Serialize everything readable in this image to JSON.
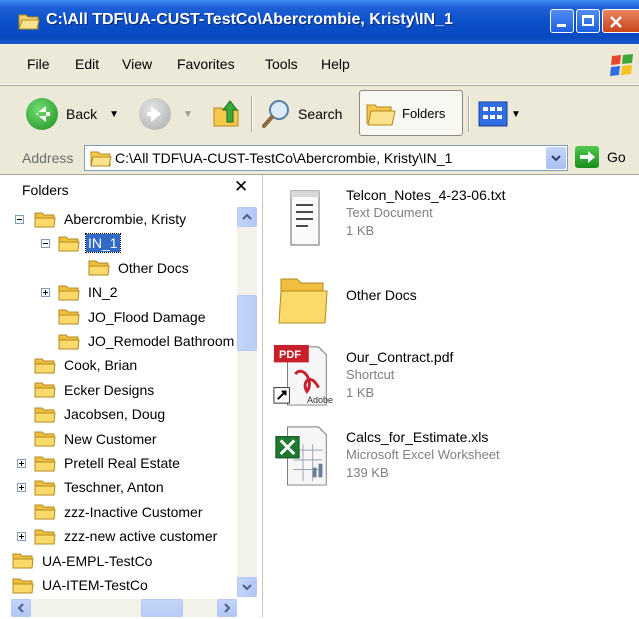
{
  "window": {
    "title": "C:\\All TDF\\UA-CUST-TestCo\\Abercrombie, Kristy\\IN_1"
  },
  "menu": {
    "items": [
      "File",
      "Edit",
      "View",
      "Favorites",
      "Tools",
      "Help"
    ]
  },
  "toolbar": {
    "back_label": "Back",
    "search_label": "Search",
    "folders_label": "Folders"
  },
  "address": {
    "label": "Address",
    "value": "C:\\All TDF\\UA-CUST-TestCo\\Abercrombie, Kristy\\IN_1",
    "go_label": "Go"
  },
  "folders_pane": {
    "title": "Folders",
    "tree": [
      {
        "label": "Abercrombie, Kristy",
        "expander": "minus",
        "selected": false
      },
      {
        "label": "IN_1",
        "expander": "minus",
        "selected": true
      },
      {
        "label": "Other Docs",
        "expander": "none",
        "selected": false
      },
      {
        "label": "IN_2",
        "expander": "plus",
        "selected": false
      },
      {
        "label": "JO_Flood Damage",
        "expander": "none",
        "selected": false
      },
      {
        "label": "JO_Remodel Bathroom",
        "expander": "none",
        "selected": false
      },
      {
        "label": "Cook, Brian",
        "expander": "none",
        "selected": false
      },
      {
        "label": "Ecker Designs",
        "expander": "none",
        "selected": false
      },
      {
        "label": "Jacobsen, Doug",
        "expander": "none",
        "selected": false
      },
      {
        "label": "New Customer",
        "expander": "none",
        "selected": false
      },
      {
        "label": "Pretell Real Estate",
        "expander": "plus",
        "selected": false
      },
      {
        "label": "Teschner, Anton",
        "expander": "plus",
        "selected": false
      },
      {
        "label": "zzz-Inactive Customer",
        "expander": "none",
        "selected": false
      },
      {
        "label": "zzz-new active customer",
        "expander": "plus",
        "selected": false
      },
      {
        "label": "UA-EMPL-TestCo",
        "expander": "none",
        "selected": false
      },
      {
        "label": "UA-ITEM-TestCo",
        "expander": "none",
        "selected": false
      }
    ]
  },
  "files": [
    {
      "name": "Telcon_Notes_4-23-06.txt",
      "type": "Text Document",
      "size": "1 KB",
      "icon": "text-document-icon"
    },
    {
      "name": "Other Docs",
      "type": "",
      "size": "",
      "icon": "folder-icon"
    },
    {
      "name": "Our_Contract.pdf",
      "type": "Shortcut",
      "size": "1 KB",
      "icon": "pdf-shortcut-icon",
      "badge_pdf": "PDF",
      "badge_adobe": "Adobe"
    },
    {
      "name": "Calcs_for_Estimate.xls",
      "type": "Microsoft Excel Worksheet",
      "size": "139 KB",
      "icon": "excel-worksheet-icon"
    }
  ],
  "colors": {
    "titlebar": "#0a4ec9",
    "chrome": "#ece9d8",
    "selection": "#316ac5",
    "folder": "#f5c84c"
  }
}
